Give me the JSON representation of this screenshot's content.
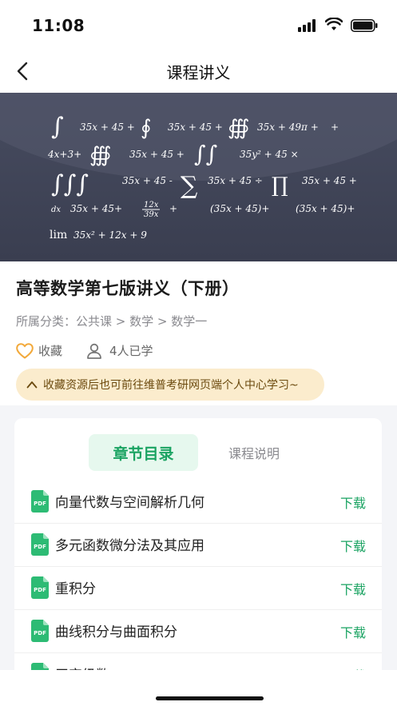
{
  "status": {
    "time": "11:08"
  },
  "nav": {
    "title": "课程讲义"
  },
  "banner": {
    "formulas": [
      "35x + 45 +",
      "35x + 45 +",
      "35x + 49π +",
      "4x+3+",
      "35x + 45 +",
      "35y² + 45 ×",
      "35x + 45 -",
      "35x + 45 ÷",
      "35x + 45 +",
      "35x + 45+",
      "(35x + 45)+",
      "(35x + 45)+",
      "lim",
      "35x² + 12x + 9"
    ]
  },
  "course": {
    "title": "高等数学第七版讲义（下册）",
    "category": "所属分类：公共课 > 数学 > 数学一",
    "favorite_label": "收藏",
    "learners_label": "4人已学",
    "tip": "收藏资源后也可前往维普考研网页端个人中心学习~"
  },
  "tabs": [
    {
      "label": "章节目录",
      "active": true
    },
    {
      "label": "课程说明",
      "active": false
    }
  ],
  "chapters": [
    {
      "title": "向量代数与空间解析几何",
      "action": "下载"
    },
    {
      "title": "多元函数微分法及其应用",
      "action": "下载"
    },
    {
      "title": "重积分",
      "action": "下载"
    },
    {
      "title": "曲线积分与曲面积分",
      "action": "下载"
    },
    {
      "title": "无穷级数",
      "action": "下载"
    }
  ],
  "icons": {
    "pdf_label": "PDF"
  },
  "colors": {
    "accent": "#1aa362",
    "tip_bg": "#fbeccd",
    "heart": "#f2a93b",
    "banner_bg": "#3f4357"
  }
}
